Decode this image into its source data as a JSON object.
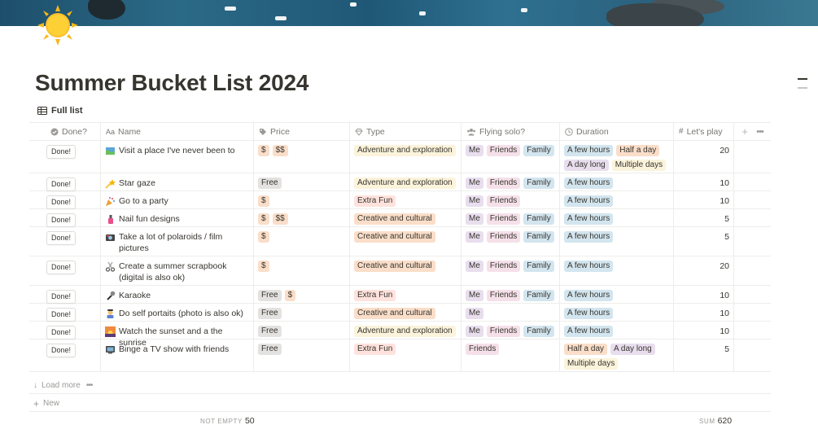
{
  "page": {
    "icon": "sun-icon",
    "title": "Summer Bucket List 2024",
    "view_tab": "Full list"
  },
  "columns": {
    "done": "Done?",
    "name": "Name",
    "price": "Price",
    "type": "Type",
    "solo": "Flying solo?",
    "duration": "Duration",
    "play": "Let's play"
  },
  "rows": [
    {
      "done": "Done!",
      "emoji": "map-icon",
      "name": "Visit a place I've never been to",
      "price": [
        "$",
        "$$"
      ],
      "type": "Adventure and exploration",
      "solo": [
        "Me",
        "Friends",
        "Family"
      ],
      "duration": [
        "A few hours",
        "Half a day",
        "A day long",
        "Multiple days"
      ],
      "play": "20"
    },
    {
      "done": "Done!",
      "emoji": "shooting-star-icon",
      "name": "Star gaze",
      "price": [
        "Free"
      ],
      "type": "Adventure and exploration",
      "solo": [
        "Me",
        "Friends",
        "Family"
      ],
      "duration": [
        "A few hours"
      ],
      "play": "10"
    },
    {
      "done": "Done!",
      "emoji": "party-popper-icon",
      "name": "Go to a party",
      "price": [
        "$"
      ],
      "type": "Extra Fun",
      "solo": [
        "Me",
        "Friends"
      ],
      "duration": [
        "A few hours"
      ],
      "play": "10"
    },
    {
      "done": "Done!",
      "emoji": "nail-polish-icon",
      "name": "Nail fun designs",
      "price": [
        "$",
        "$$"
      ],
      "type": "Creative and cultural",
      "solo": [
        "Me",
        "Friends",
        "Family"
      ],
      "duration": [
        "A few hours"
      ],
      "play": "5"
    },
    {
      "done": "Done!",
      "emoji": "camera-icon",
      "name": "Take a lot of polaroids / film pictures",
      "price": [
        "$"
      ],
      "type": "Creative and cultural",
      "solo": [
        "Me",
        "Friends",
        "Family"
      ],
      "duration": [
        "A few hours"
      ],
      "play": "5"
    },
    {
      "done": "Done!",
      "emoji": "scissors-icon",
      "name": "Create a summer scrapbook (digital is also ok)",
      "price": [
        "$"
      ],
      "type": "Creative and cultural",
      "solo": [
        "Me",
        "Friends",
        "Family"
      ],
      "duration": [
        "A few hours"
      ],
      "play": "20"
    },
    {
      "done": "Done!",
      "emoji": "microphone-icon",
      "name": "Karaoke",
      "price": [
        "Free",
        "$"
      ],
      "type": "Extra Fun",
      "solo": [
        "Me",
        "Friends",
        "Family"
      ],
      "duration": [
        "A few hours"
      ],
      "play": "10"
    },
    {
      "done": "Done!",
      "emoji": "artist-icon",
      "name": "Do self portaits (photo is also ok)",
      "price": [
        "Free"
      ],
      "type": "Creative and cultural",
      "solo": [
        "Me"
      ],
      "duration": [
        "A few hours"
      ],
      "play": "10"
    },
    {
      "done": "Done!",
      "emoji": "sunset-icon",
      "name": "Watch the sunset and a the sunrise",
      "price": [
        "Free"
      ],
      "type": "Adventure and exploration",
      "solo": [
        "Me",
        "Friends",
        "Family"
      ],
      "duration": [
        "A few hours"
      ],
      "play": "10"
    },
    {
      "done": "Done!",
      "emoji": "tv-icon",
      "name": "Binge a TV show with friends",
      "price": [
        "Free"
      ],
      "type": "Extra Fun",
      "solo": [
        "Friends"
      ],
      "duration": [
        "Half a day",
        "A day long",
        "Multiple days"
      ],
      "play": "5"
    }
  ],
  "footer": {
    "load_more": "Load more",
    "new": "New",
    "calc_left_label": "NOT EMPTY",
    "calc_left_value": "50",
    "calc_right_label": "SUM",
    "calc_right_value": "620"
  },
  "tag_colors": {
    "$": "#fadec9",
    "$$": "#fadec9",
    "Free": "#e3e2e0",
    "Adventure and exploration": "#fbf3db",
    "Extra Fun": "#ffe2dd",
    "Creative and cultural": "#fadec9",
    "Me": "#e8deee",
    "Friends": "#f5e0e9",
    "Family": "#d3e5ef",
    "A few hours": "#d3e5ef",
    "Half a day": "#fadec9",
    "A day long": "#e8deee",
    "Multiple days": "#fbf3db"
  }
}
